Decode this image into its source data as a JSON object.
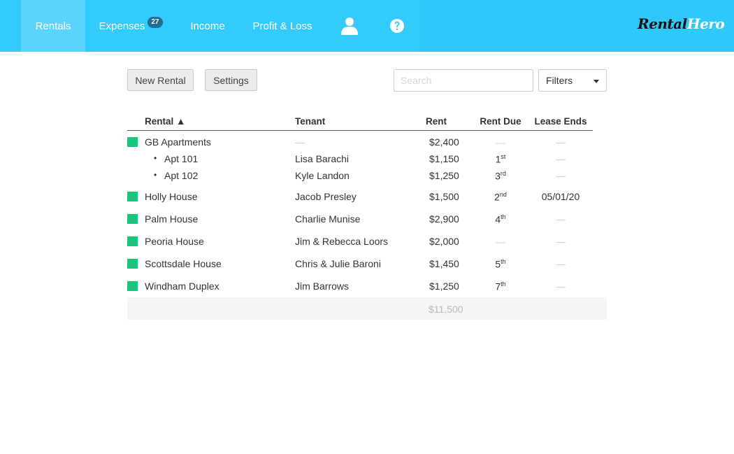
{
  "nav": {
    "rentals": "Rentals",
    "expenses": "Expenses",
    "expenses_badge": "27",
    "income": "Income",
    "profit_loss": "Profit & Loss",
    "user_icon": "user-icon",
    "help_icon": "help-icon",
    "logo_part1": "Rental",
    "logo_part2": "Hero"
  },
  "toolbar": {
    "new_rental": "New Rental",
    "settings": "Settings",
    "search_placeholder": "Search",
    "filters": "Filters"
  },
  "table": {
    "headers": {
      "rental": "Rental ▲",
      "tenant": "Tenant",
      "rent": "Rent",
      "rent_due": "Rent Due",
      "lease_ends": "Lease Ends"
    },
    "rows": [
      {
        "name": "GB Apartments",
        "tenant": "—",
        "rent": "$2,400",
        "due_num": "—",
        "due_suffix": "",
        "lease": "—"
      },
      {
        "name": "Apt 101",
        "tenant": "Lisa Barachi",
        "rent": "$1,150",
        "due_num": "1",
        "due_suffix": "st",
        "lease": "—"
      },
      {
        "name": "Apt 102",
        "tenant": "Kyle Landon",
        "rent": "$1,250",
        "due_num": "3",
        "due_suffix": "rd",
        "lease": "—"
      },
      {
        "name": "Holly House",
        "tenant": "Jacob Presley",
        "rent": "$1,500",
        "due_num": "2",
        "due_suffix": "nd",
        "lease": "05/01/20"
      },
      {
        "name": "Palm House",
        "tenant": "Charlie Munise",
        "rent": "$2,900",
        "due_num": "4",
        "due_suffix": "th",
        "lease": "—"
      },
      {
        "name": "Peoria House",
        "tenant": "Jim & Rebecca Loors",
        "rent": "$2,000",
        "due_num": "—",
        "due_suffix": "",
        "lease": "—"
      },
      {
        "name": "Scottsdale House",
        "tenant": "Chris & Julie Baroni",
        "rent": "$1,450",
        "due_num": "5",
        "due_suffix": "th",
        "lease": "—"
      },
      {
        "name": "Windham Duplex",
        "tenant": "Jim Barrows",
        "rent": "$1,250",
        "due_num": "7",
        "due_suffix": "th",
        "lease": "—"
      }
    ],
    "total": "$11,500",
    "bullet": "•"
  },
  "colors": {
    "nav_bg": "#2ec8fb",
    "active_tab": "#5ad4fd",
    "rental_swatch": "#1dc47c",
    "badge": "#1f6f93"
  }
}
